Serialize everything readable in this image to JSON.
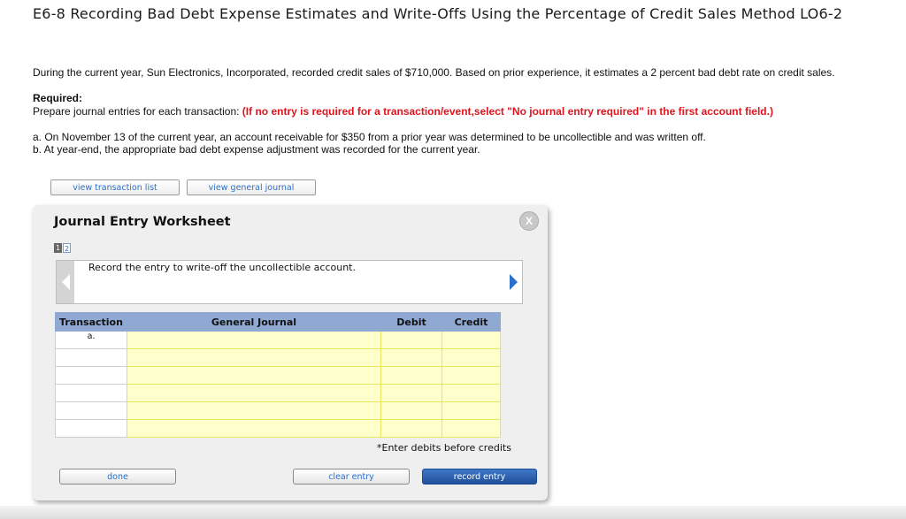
{
  "header": {
    "title": "E6-8 Recording Bad Debt Expense Estimates and Write-Offs Using the Percentage of Credit Sales Method LO6-2"
  },
  "problem": {
    "intro": "During the current year, Sun Electronics, Incorporated, recorded credit sales of $710,000. Based on prior experience, it estimates a 2 percent bad debt rate on credit sales.",
    "required_label": "Required:",
    "required_text": "Prepare journal entries for each transaction: ",
    "required_emphasis": "(If no entry is required for a transaction/event,select \"No journal entry required\" in the first account field.)",
    "item_a": "a. On November 13 of the current year, an account receivable for $350 from a prior year was determined to be uncollectible and was written off.",
    "item_b": "b. At year-end, the appropriate bad debt expense adjustment was recorded for the current year."
  },
  "top_buttons": {
    "transaction_list": "view transaction list",
    "general_journal": "view general journal"
  },
  "worksheet": {
    "title": "Journal Entry Worksheet",
    "close": "X",
    "pages": [
      "1",
      "2"
    ],
    "current_page": 1,
    "instruction": "Record the entry to write-off the uncollectible account.",
    "columns": {
      "transaction": "Transaction",
      "general_journal": "General Journal",
      "debit": "Debit",
      "credit": "Credit"
    },
    "rows": [
      {
        "transaction": "a."
      },
      {
        "transaction": ""
      },
      {
        "transaction": ""
      },
      {
        "transaction": ""
      },
      {
        "transaction": ""
      },
      {
        "transaction": ""
      }
    ],
    "note": "*Enter debits before credits",
    "buttons": {
      "done": "done",
      "clear": "clear entry",
      "record": "record entry"
    }
  }
}
